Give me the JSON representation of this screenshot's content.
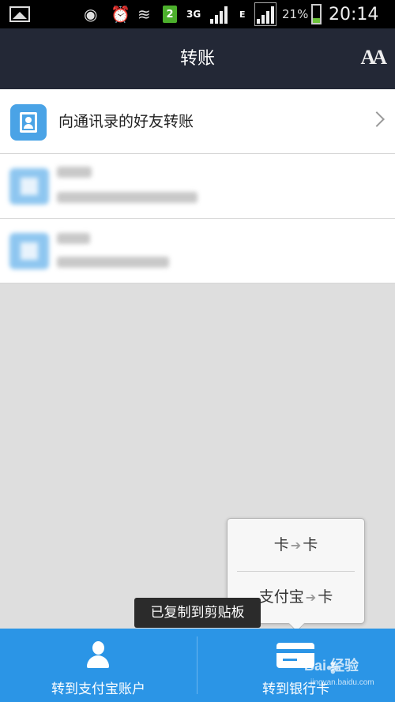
{
  "status_bar": {
    "network": "3G",
    "network2": "E",
    "sim_badge": "2",
    "battery_pct": "21%",
    "time": "20:14"
  },
  "header": {
    "title": "转账",
    "font_size_icon": "AA"
  },
  "list": {
    "contacts_transfer_label": "向通讯录的好友转账"
  },
  "popup": {
    "item1_left": "卡",
    "item1_right": "卡",
    "item2_left": "支付宝",
    "item2_right": "卡",
    "arrow": "➔"
  },
  "toast": {
    "text": "已复制到剪贴板"
  },
  "bottom_bar": {
    "left_label": "转到支付宝账户",
    "right_label": "转到银行卡"
  },
  "watermark": {
    "text": "Bai 经验",
    "sub": "jingyan.baidu.com"
  },
  "colors": {
    "header_bg": "#232836",
    "accent": "#2b95e6",
    "icon_blue": "#4aa3e6"
  }
}
